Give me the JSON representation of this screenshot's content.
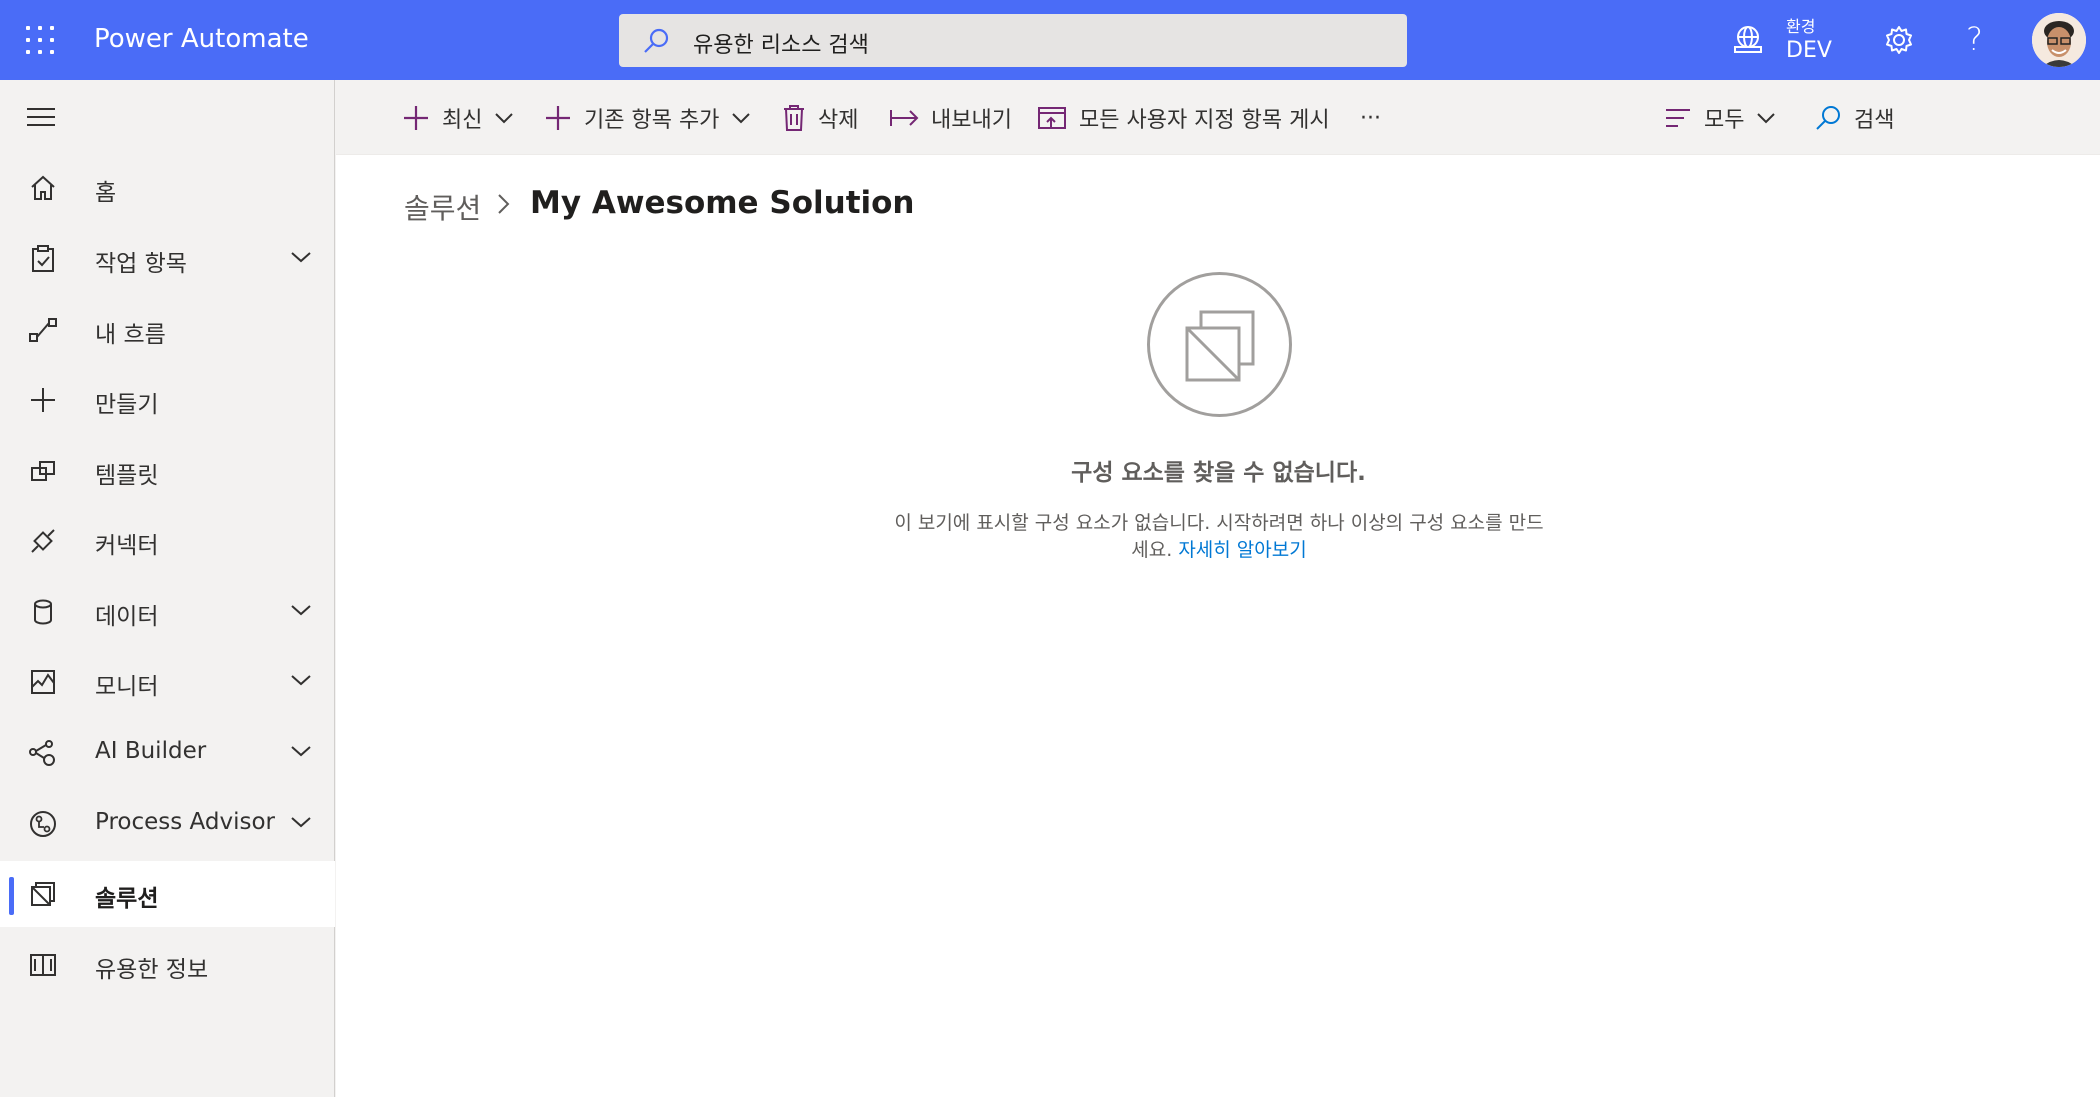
{
  "header": {
    "app_title": "Power Automate",
    "search_placeholder": "유용한 리소스 검색",
    "env_label": "환경",
    "env_name": "DEV",
    "help_glyph": "?",
    "brand_color": "#4a6cf7"
  },
  "sidebar": {
    "items": [
      {
        "label": "홈",
        "icon": "home-icon",
        "expandable": false
      },
      {
        "label": "작업 항목",
        "icon": "clipboard-icon",
        "expandable": true
      },
      {
        "label": "내 흐름",
        "icon": "flow-icon",
        "expandable": false
      },
      {
        "label": "만들기",
        "icon": "plus-icon",
        "expandable": false
      },
      {
        "label": "템플릿",
        "icon": "template-icon",
        "expandable": false
      },
      {
        "label": "커넥터",
        "icon": "connector-icon",
        "expandable": false
      },
      {
        "label": "데이터",
        "icon": "database-icon",
        "expandable": true
      },
      {
        "label": "모니터",
        "icon": "monitor-icon",
        "expandable": true
      },
      {
        "label": "AI Builder",
        "icon": "ai-builder-icon",
        "expandable": true
      },
      {
        "label": "Process Advisor",
        "icon": "process-advisor-icon",
        "expandable": true
      },
      {
        "label": "솔루션",
        "icon": "solution-icon",
        "expandable": false,
        "active": true
      },
      {
        "label": "유용한 정보",
        "icon": "book-icon",
        "expandable": false
      }
    ]
  },
  "commandbar": {
    "new_label": "최신",
    "add_existing_label": "기존 항목 추가",
    "delete_label": "삭제",
    "export_label": "내보내기",
    "publish_label": "모든 사용자 지정 항목 게시",
    "more_label": "···",
    "filter_label": "모두",
    "search_label": "검색"
  },
  "breadcrumb": {
    "root": "솔루션",
    "current": "My Awesome Solution"
  },
  "empty_state": {
    "title": "구성 요소를 찾을 수 없습니다.",
    "description": "이 보기에 표시할 구성 요소가 없습니다. 시작하려면 하나 이상의 구성 요소를 만드세요.",
    "link": "자세히 알아보기"
  }
}
